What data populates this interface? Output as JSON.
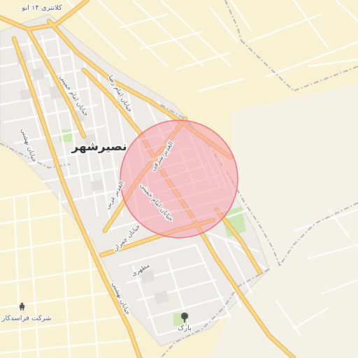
{
  "map": {
    "city_label": "نصیرشهر",
    "top_label": "کلانتری ۱۴ ابو",
    "company_label": "شرکت فراسدکار",
    "park_label": "پارک",
    "streets": {
      "imam_khomeini_n": "خیابان امام خمینی",
      "imam_reza": "خیابان امام رضا",
      "beheshti_w": "خیابان بهشتی",
      "ghadir_sharghi": "الغدیر شرقی",
      "ghadir_gharbi": "الغدیر غربی",
      "imam_khomeini_s": "خیابان امام خمینی",
      "chamran": "خیابان چمران",
      "motahari": "مطهری",
      "beheshti_s": "خیابان بهشتی"
    },
    "colors": {
      "farmland": "#f8f1d3",
      "urban": "#eeeae6",
      "blocks": "#e3dfda",
      "road_major": "#fbd788",
      "road_major_casing": "#e0b45c",
      "road_minor": "#ffffff",
      "park": "#cfe6b4",
      "highlight_fill": "#f6a1ad",
      "highlight_stroke": "#e8727f",
      "boundary": "#a7a7b6"
    },
    "icons": [
      "park-tree-icon",
      "company-icon"
    ]
  }
}
